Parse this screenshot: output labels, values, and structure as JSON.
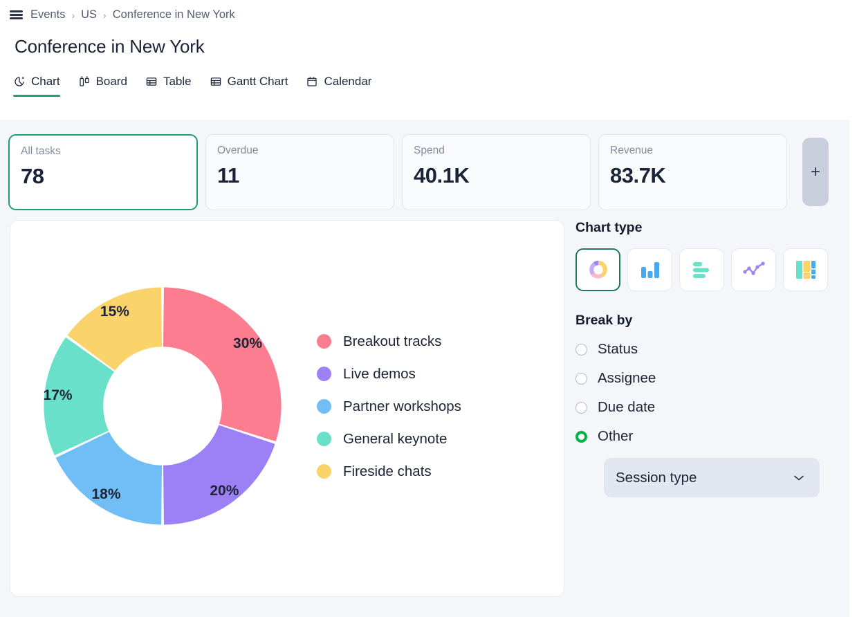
{
  "breadcrumb": {
    "menu_icon": "hamburger-icon",
    "items": [
      "Events",
      "US",
      "Conference in New York"
    ],
    "separator": "›"
  },
  "header": {
    "title": "Conference in New York"
  },
  "tabs": [
    {
      "label": "Chart",
      "icon": "pie-chart-icon",
      "active": true
    },
    {
      "label": "Board",
      "icon": "board-icon",
      "active": false
    },
    {
      "label": "Table",
      "icon": "table-icon",
      "active": false
    },
    {
      "label": "Gantt Chart",
      "icon": "gantt-icon",
      "active": false
    },
    {
      "label": "Calendar",
      "icon": "calendar-icon",
      "active": false
    }
  ],
  "stats": {
    "cards": [
      {
        "label": "All tasks",
        "value": "78",
        "selected": true
      },
      {
        "label": "Overdue",
        "value": "11",
        "selected": false
      },
      {
        "label": "Spend",
        "value": "40.1K",
        "selected": false
      },
      {
        "label": "Revenue",
        "value": "83.7K",
        "selected": false
      }
    ],
    "add_label": "+",
    "add_icon": "plus-icon"
  },
  "chart_data": {
    "type": "pie",
    "variant": "donut",
    "title": "",
    "legend_position": "right",
    "categories": [
      "Breakout tracks",
      "Live demos",
      "Partner workshops",
      "General keynote",
      "Fireside chats"
    ],
    "values": [
      30,
      20,
      18,
      17,
      15
    ],
    "labels": [
      "30%",
      "20%",
      "18%",
      "17%",
      "15%"
    ],
    "colors": [
      "#fb7d8f",
      "#9c80f5",
      "#71bdf5",
      "#69e0ca",
      "#fbd36b"
    ],
    "unit": "%"
  },
  "side_panel": {
    "chart_type": {
      "heading": "Chart type",
      "options": [
        {
          "icon": "donut-chart-icon",
          "name": "donut",
          "active": true
        },
        {
          "icon": "bar-chart-icon",
          "name": "bar",
          "active": false
        },
        {
          "icon": "hbar-chart-icon",
          "name": "horizontal-bar",
          "active": false
        },
        {
          "icon": "line-chart-icon",
          "name": "line",
          "active": false
        },
        {
          "icon": "stacked-chart-icon",
          "name": "stacked",
          "active": false
        }
      ]
    },
    "break_by": {
      "heading": "Break by",
      "options": [
        {
          "label": "Status",
          "selected": false
        },
        {
          "label": "Assignee",
          "selected": false
        },
        {
          "label": "Due date",
          "selected": false
        },
        {
          "label": "Other",
          "selected": true
        }
      ],
      "select": {
        "value": "Session type",
        "chevron_icon": "chevron-down-icon"
      }
    }
  },
  "colors": {
    "accent_green": "#21a179",
    "radio_green": "#00b246",
    "surface": "#f4f6f9",
    "card_border": "#dfe3ea",
    "text_dark": "#1d2436",
    "text_muted": "#828b9e"
  }
}
